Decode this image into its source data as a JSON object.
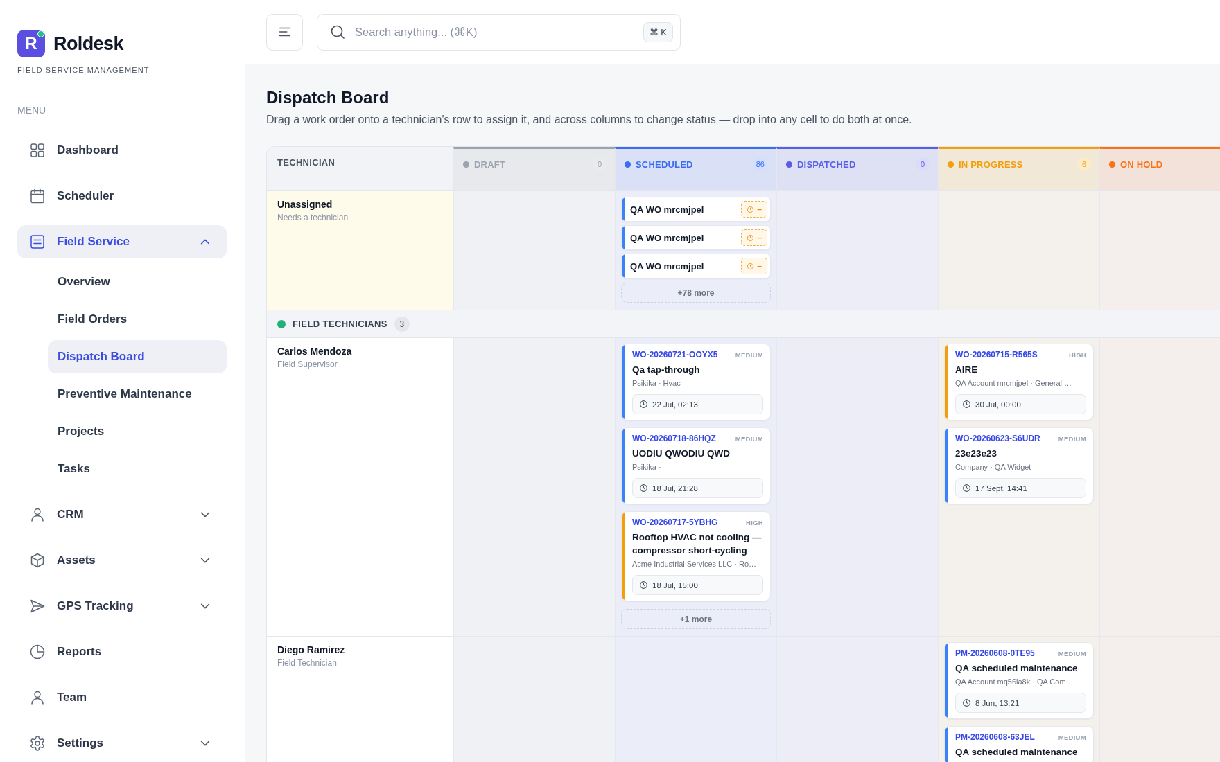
{
  "brand": {
    "logo_mark": "R",
    "name": "Roldesk",
    "tagline": "FIELD SERVICE MANAGEMENT"
  },
  "sidebar": {
    "heading": "MENU",
    "items": [
      {
        "kind": "link",
        "label": "Dashboard",
        "selected": false
      },
      {
        "kind": "link",
        "label": "Scheduler",
        "selected": false
      },
      {
        "kind": "group",
        "label": "Field Service",
        "selected": true,
        "expanded": true,
        "children": [
          {
            "label": "Overview",
            "selected": false
          },
          {
            "label": "Field Orders",
            "selected": false
          },
          {
            "label": "Dispatch Board",
            "selected": true
          },
          {
            "label": "Preventive Maintenance",
            "selected": false
          },
          {
            "label": "Projects",
            "selected": false
          },
          {
            "label": "Tasks",
            "selected": false
          }
        ]
      },
      {
        "kind": "group",
        "label": "CRM",
        "selected": false,
        "expanded": false
      },
      {
        "kind": "group",
        "label": "Assets",
        "selected": false,
        "expanded": false
      },
      {
        "kind": "group",
        "label": "GPS Tracking",
        "selected": false,
        "expanded": false
      },
      {
        "kind": "link",
        "label": "Reports",
        "selected": false
      },
      {
        "kind": "link",
        "label": "Team",
        "selected": false
      },
      {
        "kind": "group",
        "label": "Settings",
        "selected": false,
        "expanded": false
      }
    ]
  },
  "topbar": {
    "search": {
      "placeholder": "Search anything... (⌘K)",
      "shortcut": "⌘ K"
    }
  },
  "page": {
    "title": "Dispatch Board",
    "description": "Drag a work order onto a technician's row to assign it, and across columns to change status — drop into any cell to do both at once."
  },
  "board": {
    "technician_heading": "TECHNICIAN",
    "columns": [
      {
        "label": "DRAFT",
        "count": "0",
        "color": "#9ca3af"
      },
      {
        "label": "SCHEDULED",
        "count": "86",
        "color": "#3b6cf6"
      },
      {
        "label": "DISPATCHED",
        "count": "0",
        "color": "#5a5de8"
      },
      {
        "label": "IN PROGRESS",
        "count": "6",
        "color": "#f59e0b"
      },
      {
        "label": "ON HOLD",
        "color": "#f97316"
      }
    ],
    "rows": [
      {
        "kind": "unassigned",
        "name": "Unassigned",
        "subtitle": "Needs a technician",
        "cells": [
          {},
          {
            "cards": [
              {
                "kind": "compact",
                "title": "QA WO mrcmjpel",
                "due": "–",
                "color": "#3b82f6"
              },
              {
                "kind": "compact",
                "title": "QA WO mrcmjpel",
                "due": "–",
                "color": "#3b82f6"
              },
              {
                "kind": "compact",
                "title": "QA WO mrcmjpel",
                "due": "–",
                "color": "#3b82f6"
              }
            ],
            "more": "+78 more"
          },
          {},
          {},
          {}
        ]
      },
      {
        "kind": "group",
        "label": "FIELD TECHNICIANS",
        "count": "3"
      },
      {
        "kind": "technician",
        "name": "Carlos Mendoza",
        "subtitle": "Field Supervisor",
        "cells": [
          {},
          {
            "cards": [
              {
                "kind": "full",
                "number": "WO-20260721-OOYX5",
                "priority": "MEDIUM",
                "title": "Qa tap-through",
                "meta": "Psikika · Hvac",
                "date": "22 Jul, 02:13",
                "color": "#3b82f6"
              },
              {
                "kind": "full",
                "number": "WO-20260718-86HQZ",
                "priority": "MEDIUM",
                "title": "UODIU QWODIU QWD",
                "meta": "Psikika ·",
                "date": "18 Jul, 21:28",
                "color": "#3b82f6"
              },
              {
                "kind": "full",
                "number": "WO-20260717-5YBHG",
                "priority": "HIGH",
                "title": "Rooftop HVAC not cooling — compressor short-cycling",
                "meta": "Acme Industrial Services LLC · Ro…",
                "date": "18 Jul, 15:00",
                "color": "#f59e0b"
              }
            ],
            "more": "+1 more"
          },
          {},
          {
            "cards": [
              {
                "kind": "full",
                "number": "WO-20260715-R565S",
                "priority": "HIGH",
                "title": "AIRE",
                "meta": "QA Account mrcmjpel · General …",
                "date": "30 Jul, 00:00",
                "color": "#f59e0b"
              },
              {
                "kind": "full",
                "number": "WO-20260623-S6UDR",
                "priority": "MEDIUM",
                "title": "23e23e23",
                "meta": "Company · QA Widget",
                "date": "17 Sept, 14:41",
                "color": "#3b82f6"
              }
            ]
          },
          {}
        ]
      },
      {
        "kind": "technician",
        "name": "Diego Ramirez",
        "subtitle": "Field Technician",
        "cells": [
          {},
          {},
          {},
          {
            "cards": [
              {
                "kind": "full",
                "number": "PM-20260608-0TE95",
                "priority": "MEDIUM",
                "title": "QA scheduled maintenance",
                "meta": "QA Account mq56ia8k · QA Com…",
                "date": "8 Jun, 13:21",
                "color": "#3b82f6"
              },
              {
                "kind": "full",
                "number": "PM-20260608-63JEL",
                "priority": "MEDIUM",
                "title": "QA scheduled maintenance",
                "color": "#3b82f6"
              }
            ]
          },
          {}
        ]
      }
    ]
  }
}
